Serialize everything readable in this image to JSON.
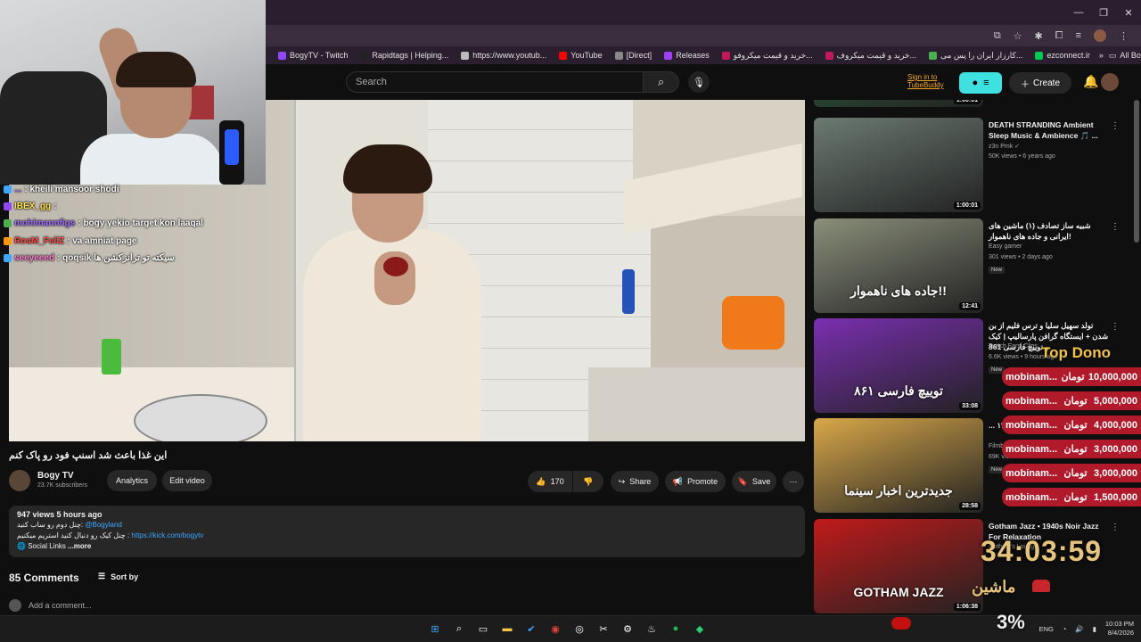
{
  "browser": {
    "window_controls": {
      "minimize": "—",
      "maximize": "❐",
      "close": "✕"
    },
    "bookmarks": [
      {
        "label": "BogyTV - Twitch",
        "color": "#9146ff"
      },
      {
        "label": "Rapidtags | Helping...",
        "color": "#222222"
      },
      {
        "label": "https://www.youtub...",
        "color": "#bbbbbb"
      },
      {
        "label": "YouTube",
        "color": "#ff0000"
      },
      {
        "label": "[Direct]",
        "color": "#888888"
      },
      {
        "label": "Releases",
        "color": "#a040ff"
      },
      {
        "label": "خرید و قیمت میکروفو...",
        "color": "#c2185b"
      },
      {
        "label": "خرید و قیمت میکروف...",
        "color": "#c2185b"
      },
      {
        "label": "کارزار ایران را پس می...",
        "color": "#4caf50"
      },
      {
        "label": "ezconnect.ir",
        "color": "#00c853"
      }
    ],
    "all_bookmarks": "All Bookmarks",
    "more_bookmarks": "»"
  },
  "youtube": {
    "search": {
      "placeholder": "Search"
    },
    "tubebuddy": {
      "line1": "Sign in to",
      "line2": "TubeBuddy"
    },
    "create_label": "Create"
  },
  "chat": [
    {
      "user": "...",
      "msg": ": kheili mansoor shodi",
      "color": "purple"
    },
    {
      "user": "IBEX_gg",
      "msg": ":",
      "color": "yellow"
    },
    {
      "user": "mohimannfigs",
      "msg": ": bogy yekio target kon laaqal",
      "color": "purple"
    },
    {
      "user": "RosM_FeliZ",
      "msg": ": va amniat page",
      "color": "red"
    },
    {
      "user": "seeyeeed",
      "msg": ": qoqsik سیکته تو ترانزکشن ها",
      "color": "pink"
    }
  ],
  "video": {
    "title": "این غذا باعث شد اسنپ فود رو پاک کنم",
    "channel": {
      "name": "Bogy TV",
      "subs": "23.7K subscribers"
    },
    "buttons": {
      "analytics": "Analytics",
      "edit": "Edit video",
      "likes": "170",
      "share": "Share",
      "promote": "Promote",
      "save": "Save",
      "more": "⋯"
    },
    "description": {
      "stats": "947 views  5 hours ago",
      "line1_text": "چنل دوم رو ساب کنید: ",
      "line1_link": "@Bogyland",
      "line2_text": "چنل کیک رو دنبال کنید استریم میکنیم : ",
      "line2_link": "https://kick.com/bogytv",
      "line3": "Social Links",
      "more": "...more"
    },
    "comments_count": "85 Comments",
    "sort_by": "Sort by",
    "add_comment": "Add a comment..."
  },
  "sidebar": [
    {
      "title": "",
      "channel": "",
      "meta": "",
      "duration": "1:00:01",
      "thumb": "#2f6b3f",
      "partial": true
    },
    {
      "title": "DEATH STRANDING Ambient Sleep Music & Ambience 🎵 ...",
      "channel": "z3n Pmk ✓",
      "meta": "50K views • 6 years ago",
      "duration": "1:00:01",
      "thumb": "#6b7a72",
      "new": ""
    },
    {
      "title": "شبیه ساز تصادف (۱) ماشین های ایرانی و جاده های ناهموار!",
      "channel": "Easy gamer",
      "meta": "301 views • 2 days ago",
      "duration": "12:41",
      "thumb": "#8a8f7a",
      "new": "New",
      "overlay": "جاده های ناهموار!!"
    },
    {
      "title": "تولد سهیل سلیا و ترس فلیم از بن شدن + ایستگاه گرافن پارسالیپ | کیک و توییچ فارسی 861",
      "channel": "Twitch Farsi Clips",
      "meta": "6.6K views • 9 hours ago",
      "duration": "33:08",
      "thumb": "#7a2fb0",
      "new": "New",
      "overlay": "توییچ فارسی ۸۶۱"
    },
    {
      "title": "... هفته ۱۴۰",
      "channel": "Filmbaz",
      "meta": "69K views",
      "duration": "28:58",
      "thumb": "#d9a84a",
      "new": "New",
      "overlay": "جدیدترین اخبار سینما"
    },
    {
      "title": "Gotham Jazz • 1940s Noir Jazz For Relaxation",
      "channel": "Gotham's Lounge",
      "meta": "",
      "duration": "1:06:38",
      "thumb": "#c11a1a",
      "overlay": "GOTHAM JAZZ"
    }
  ],
  "donations": {
    "title": "Top Dono",
    "rows": [
      {
        "user": "mobinam...",
        "amount": "10,000,000",
        "unit": "تومان"
      },
      {
        "user": "mobinam...",
        "amount": "5,000,000",
        "unit": "تومان"
      },
      {
        "user": "mobinam...",
        "amount": "4,000,000",
        "unit": "تومان"
      },
      {
        "user": "mobinam...",
        "amount": "3,000,000",
        "unit": "تومان"
      },
      {
        "user": "mobinam...",
        "amount": "3,000,000",
        "unit": "تومان"
      },
      {
        "user": "mobinam...",
        "amount": "1,500,000",
        "unit": "تومان"
      }
    ]
  },
  "overlay": {
    "timer": "34:03:59",
    "goal_label": "ماشین",
    "percent": "3%"
  },
  "taskbar": {
    "lang": "ENG",
    "time": "10:03 PM",
    "date": "8/4/2026"
  }
}
